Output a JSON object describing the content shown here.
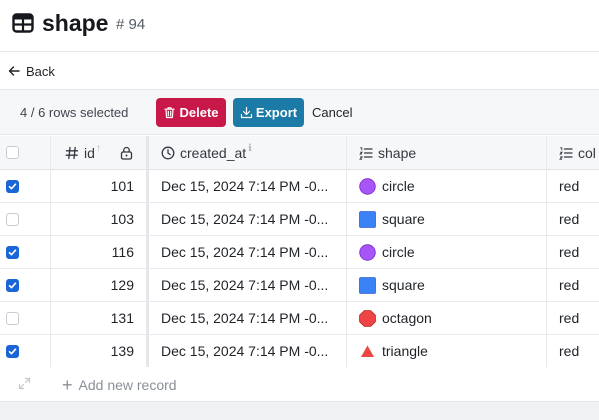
{
  "header": {
    "title": "shape",
    "record_id": "# 94",
    "icon": "table-icon"
  },
  "nav": {
    "back_label": "Back"
  },
  "toolbar": {
    "selection_text": "4 / 6 rows selected",
    "delete_label": "Delete",
    "export_label": "Export",
    "cancel_label": "Cancel"
  },
  "table": {
    "columns": [
      {
        "key": "id",
        "label": "id",
        "icon": "hash-icon",
        "locked": true,
        "sorted": "asc"
      },
      {
        "key": "created_at",
        "label": "created_at",
        "icon": "clock-icon"
      },
      {
        "key": "shape",
        "label": "shape",
        "icon": "list-icon"
      },
      {
        "key": "color",
        "label": "col",
        "icon": "list-icon"
      }
    ],
    "rows": [
      {
        "selected": true,
        "id": "101",
        "created_at": "Dec 15, 2024 7:14 PM -0...",
        "shape": "circle",
        "shape_icon": "purple-circle-icon",
        "color": "red"
      },
      {
        "selected": false,
        "id": "103",
        "created_at": "Dec 15, 2024 7:14 PM -0...",
        "shape": "square",
        "shape_icon": "blue-square-icon",
        "color": "red"
      },
      {
        "selected": true,
        "id": "116",
        "created_at": "Dec 15, 2024 7:14 PM -0...",
        "shape": "circle",
        "shape_icon": "purple-circle-icon",
        "color": "red"
      },
      {
        "selected": true,
        "id": "129",
        "created_at": "Dec 15, 2024 7:14 PM -0...",
        "shape": "square",
        "shape_icon": "blue-square-icon",
        "color": "red"
      },
      {
        "selected": false,
        "id": "131",
        "created_at": "Dec 15, 2024 7:14 PM -0...",
        "shape": "octagon",
        "shape_icon": "red-octagon-icon",
        "color": "red"
      },
      {
        "selected": true,
        "id": "139",
        "created_at": "Dec 15, 2024 7:14 PM -0...",
        "shape": "triangle",
        "shape_icon": "red-triangle-icon",
        "color": "red"
      }
    ]
  },
  "footer": {
    "add_record_label": "Add new record"
  },
  "colors": {
    "delete": "#c8184a",
    "export": "#1b7aa6",
    "checkbox": "#1a66d6",
    "circle": "#a855f7",
    "square": "#3b82f6",
    "octagon": "#ef4444",
    "triangle": "#ef4444"
  }
}
